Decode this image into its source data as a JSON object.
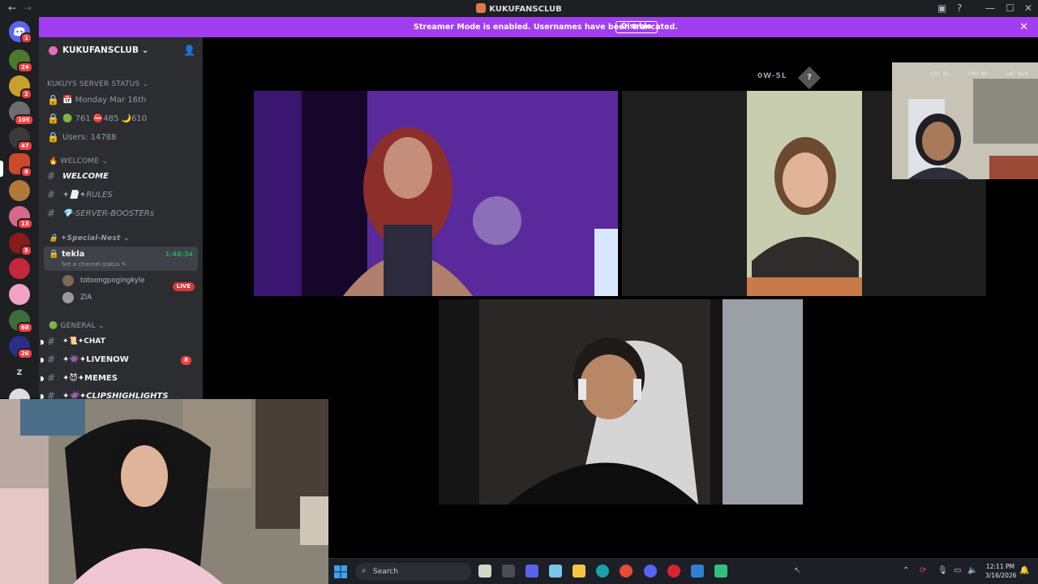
{
  "window": {
    "title": "KUKUFANSCLUB",
    "back_icon": "arrow-left-icon",
    "forward_icon": "arrow-right-icon"
  },
  "banner": {
    "message": "Streamer Mode is enabled. Usernames have been truncated.",
    "disable_label": "Disable"
  },
  "rail": {
    "badges": [
      "1",
      "24",
      "2",
      "105",
      "47",
      "8",
      "13",
      "5",
      "68",
      "26"
    ],
    "letter_server": "Z"
  },
  "server": {
    "name": "KUKUFANSCLUB",
    "categories": {
      "status": "KUKUYS SERVER STATUS",
      "welcome": "WELCOME",
      "special": "✦Special-Nest",
      "general": "GENERAL"
    },
    "status_rows": {
      "date": "Monday Mar 16th",
      "counts": "761 ⛔485 🌙610",
      "users": "Users: 14788"
    },
    "welcome_channels": {
      "welcome": "WELCOME",
      "rules": "✦📄✦RULES",
      "boosters": "💎-SERVER-BOOSTERs"
    },
    "voice": {
      "name": "tekla",
      "status": "Set a channel status",
      "timer": "1:48:34",
      "members": [
        "totoongpogingkyle",
        "ZIA"
      ],
      "live": "LIVE"
    },
    "general_channels": {
      "chat": "✦📜✦CHAT",
      "livenow": "✦👾✦LIVENOW",
      "livenow_count": "8",
      "memes": "✦😈✦MEMES",
      "clips": "✦👾✦CLIPSHIGHLIGHTS"
    }
  },
  "overlay": {
    "record": "0W-5L",
    "cpu1": "CPU 9%",
    "cpu2": "CPU 9%",
    "lat": "LAT N/A"
  },
  "taskbar": {
    "search_placeholder": "Search",
    "time": "12:11 PM",
    "date": "3/16/2026"
  }
}
